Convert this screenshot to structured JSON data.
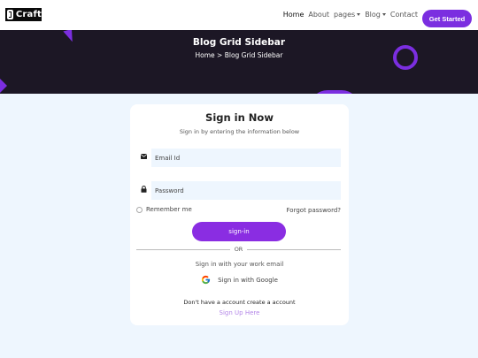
{
  "brand": {
    "name": "Craft"
  },
  "nav": {
    "items": [
      {
        "label": "Home"
      },
      {
        "label": "About"
      },
      {
        "label": "pages"
      },
      {
        "label": "Blog"
      },
      {
        "label": "Contact"
      }
    ],
    "cta": "Get Started"
  },
  "hero": {
    "title": "Blog Grid Sidebar",
    "breadcrumb": "Home > Blog Grid Sidebar"
  },
  "signin": {
    "title": "Sign in Now",
    "subtitle": "Sign in by entering the information below",
    "email_placeholder": "Email Id",
    "password_placeholder": "Password",
    "remember_label": "Remember me",
    "forgot_label": "Forgot password?",
    "submit_label": "sign-in",
    "or_label": "OR",
    "work_email_label": "Sign in with your work email",
    "google_label": "Sign in with Google",
    "no_account_label": "Don't have a account create a account",
    "signup_label": "Sign Up Here"
  },
  "colors": {
    "accent": "#7b2ee0",
    "hero_bg": "#1c1725",
    "page_bg": "#eef6fe"
  }
}
